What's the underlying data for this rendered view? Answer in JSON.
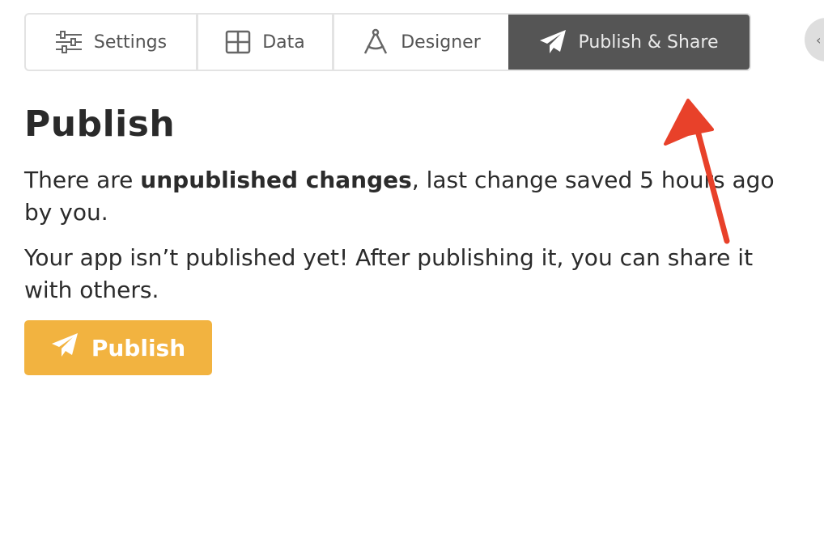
{
  "tabs": [
    {
      "label": "Settings",
      "icon": "sliders-icon",
      "active": false
    },
    {
      "label": "Data",
      "icon": "table-grid-icon",
      "active": false
    },
    {
      "label": "Designer",
      "icon": "compass-icon",
      "active": false
    },
    {
      "label": "Publish & Share",
      "icon": "paper-plane-icon",
      "active": true
    }
  ],
  "content": {
    "title": "Publish",
    "status": {
      "prefix": "There are ",
      "bold": "unpublished changes",
      "suffix": ", last change saved 5 hours ago by you."
    },
    "info": "Your app isn’t published yet! After publishing it, you can share it with others.",
    "publish_button": "Publish"
  },
  "annotation": {
    "type": "arrow",
    "color": "#e8412a",
    "points_to": "Publish & Share tab"
  },
  "colors": {
    "active_tab_bg": "#555555",
    "publish_button_bg": "#f2b340",
    "tab_border": "#e3e3e3"
  }
}
